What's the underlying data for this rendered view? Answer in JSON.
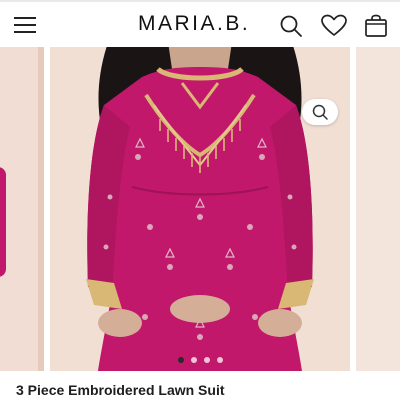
{
  "header": {
    "brand": "MARIA.B.",
    "icons": [
      "menu-icon",
      "search-icon",
      "heart-icon",
      "bag-icon"
    ]
  },
  "gallery": {
    "slide_count": 4,
    "active_slide": 1,
    "zoom_icon": "zoom-icon"
  },
  "product": {
    "title": "3 Piece Embroidered Lawn Suit"
  },
  "colors": {
    "fabric": "#c2186b",
    "embroidery": "#d9b774",
    "background": "#f2dfd4"
  }
}
